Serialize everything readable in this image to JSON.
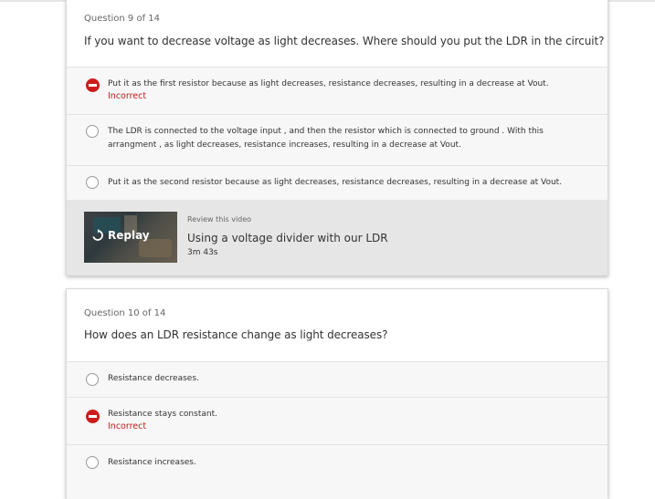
{
  "q9": {
    "number": "Question 9 of 14",
    "text": "If you want to decrease voltage as light decreases. Where should you put the LDR in the circuit?",
    "options": [
      {
        "text": "Put it as the first resistor because as light decreases, resistance decreases, resulting in a decrease at Vout.",
        "state": "selected-incorrect",
        "feedback": "Incorrect"
      },
      {
        "text": "The LDR is connected to the voltage input , and then the resistor which is connected to ground . With this arrangment , as light decreases, resistance increases, resulting in a decrease at Vout.",
        "state": "unselected"
      },
      {
        "text": "Put it as the second resistor because as light decreases, resistance decreases, resulting in a decrease at Vout.",
        "state": "unselected"
      }
    ],
    "review": {
      "label": "Review this video",
      "title": "Using a voltage divider with our LDR",
      "duration": "3m 43s",
      "replay_label": "Replay"
    }
  },
  "q10": {
    "number": "Question 10 of 14",
    "text": "How does an LDR resistance change as light decreases?",
    "options": [
      {
        "text": "Resistance decreases.",
        "state": "unselected"
      },
      {
        "text": "Resistance stays constant.",
        "state": "selected-incorrect",
        "feedback": "Incorrect"
      },
      {
        "text": "Resistance increases.",
        "state": "unselected"
      }
    ]
  },
  "icons": {
    "incorrect": "minus-circle-icon",
    "radio": "radio-empty-icon",
    "replay": "replay-icon"
  },
  "colors": {
    "incorrect": "#cc1c1c",
    "option_bg": "#f7f7f7",
    "review_bg": "#e6e6e6"
  }
}
